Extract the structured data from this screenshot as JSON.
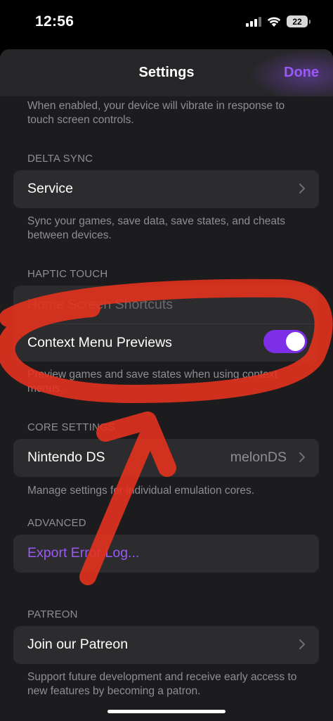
{
  "status_bar": {
    "time": "12:56",
    "battery": "22"
  },
  "nav": {
    "title": "Settings",
    "done": "Done"
  },
  "haptics": {
    "footer": "When enabled, your device will vibrate in response to touch screen controls."
  },
  "delta_sync": {
    "header": "DELTA SYNC",
    "service_label": "Service",
    "footer": "Sync your games, save data, save states, and cheats between devices."
  },
  "haptic_touch": {
    "header": "HAPTIC TOUCH",
    "home_screen_shortcuts": "Home Screen Shortcuts",
    "context_menu_previews": "Context Menu Previews",
    "context_menu_previews_on": true,
    "footer": "Preview games and save states when using context menus."
  },
  "core_settings": {
    "header": "CORE SETTINGS",
    "nintendo_ds_label": "Nintendo DS",
    "nintendo_ds_value": "melonDS",
    "footer": "Manage settings for individual emulation cores."
  },
  "advanced": {
    "header": "ADVANCED",
    "export_error_log": "Export Error Log..."
  },
  "patreon": {
    "header": "PATREON",
    "join_label": "Join our Patreon",
    "footer": "Support future development and receive early access to new features by becoming a patron."
  },
  "colors": {
    "accent": "#9a59f5",
    "toggle_on": "#7d2fe8",
    "annotation": "#e8321e",
    "background": "#1c1c1e",
    "cell": "#2c2c2e"
  },
  "icons": [
    "cellular-signal-icon",
    "wifi-icon",
    "battery-icon",
    "chevron-right-icon"
  ]
}
